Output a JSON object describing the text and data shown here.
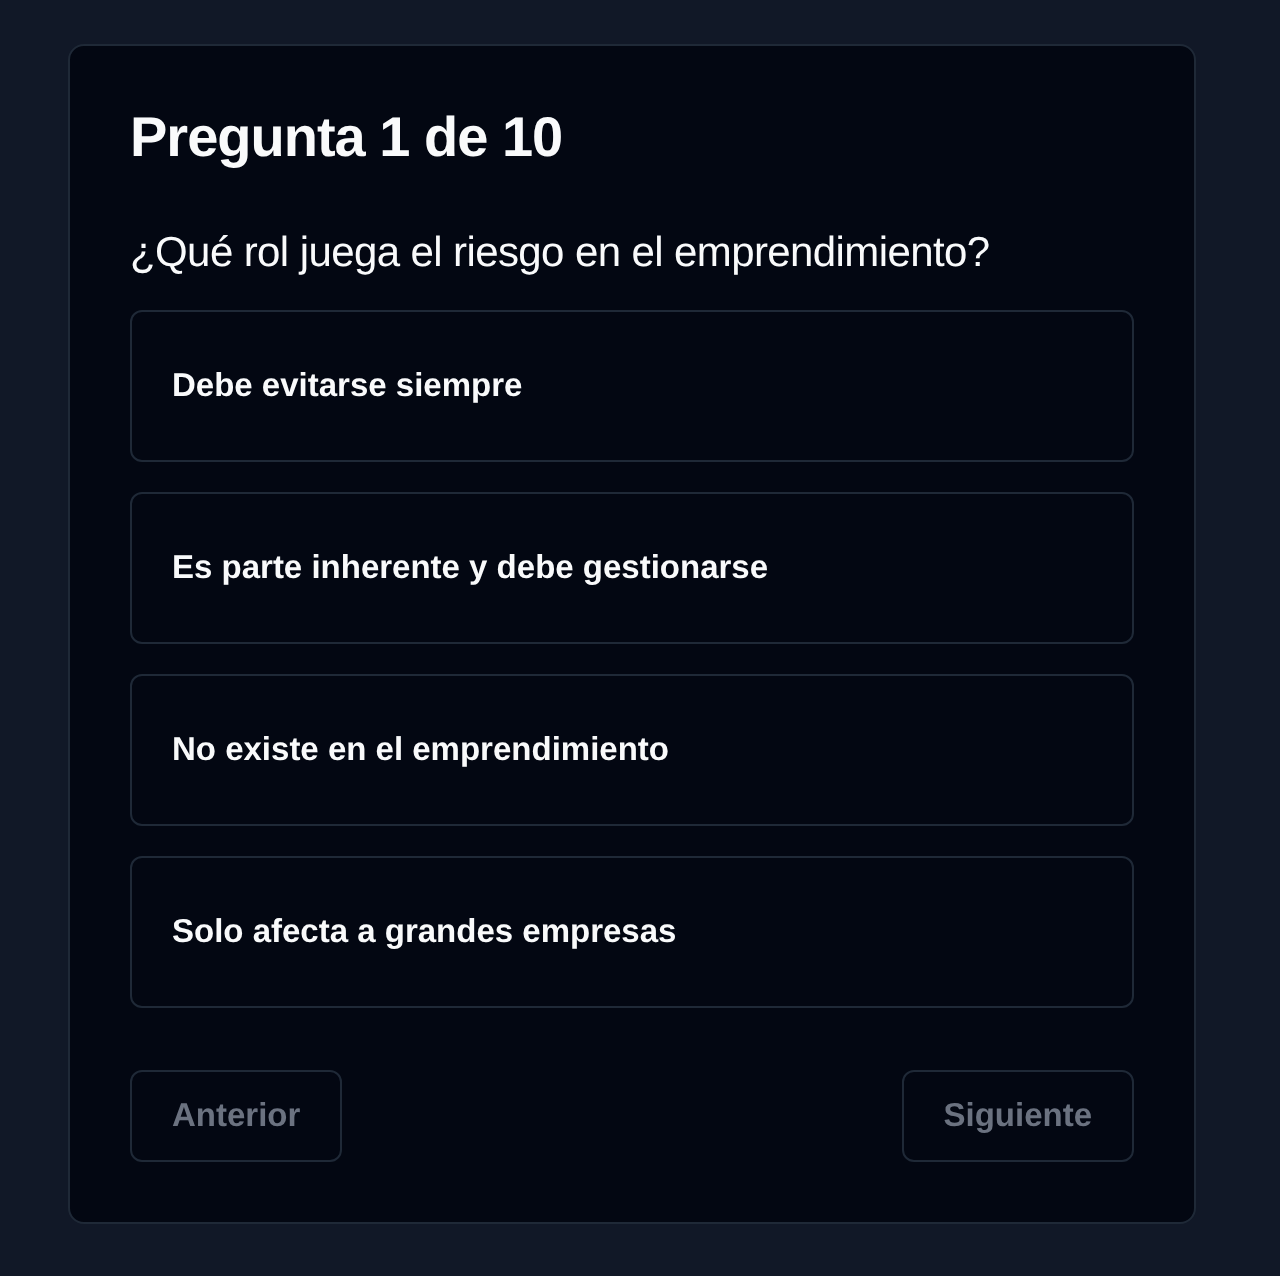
{
  "title": "Pregunta 1 de 10",
  "question": "¿Qué rol juega el riesgo en el emprendimiento?",
  "options": [
    {
      "label": "Debe evitarse siempre",
      "selected": false
    },
    {
      "label": "Es parte inherente y debe gestionarse",
      "selected": false
    },
    {
      "label": "No existe en el emprendimiento",
      "selected": false
    },
    {
      "label": "Solo afecta a grandes empresas",
      "selected": false
    }
  ],
  "buttons": [
    {
      "label": "Anterior",
      "disabled": true
    },
    {
      "label": "Siguiente",
      "disabled": true
    }
  ]
}
